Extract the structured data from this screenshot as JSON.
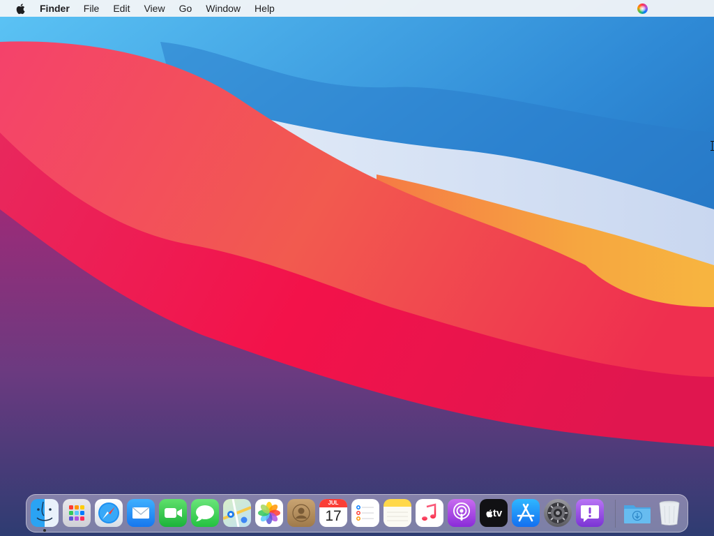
{
  "menubar": {
    "apple_icon": "apple-icon",
    "app_name": "Finder",
    "menus": [
      "File",
      "Edit",
      "View",
      "Go",
      "Window",
      "Help"
    ],
    "status_icons": [
      "siri-icon"
    ]
  },
  "dock": {
    "apps": [
      {
        "name": "Finder",
        "icon": "finder-icon",
        "running": true
      },
      {
        "name": "Launchpad",
        "icon": "launchpad-icon"
      },
      {
        "name": "Safari",
        "icon": "safari-icon"
      },
      {
        "name": "Mail",
        "icon": "mail-icon"
      },
      {
        "name": "FaceTime",
        "icon": "facetime-icon"
      },
      {
        "name": "Messages",
        "icon": "messages-icon"
      },
      {
        "name": "Maps",
        "icon": "maps-icon"
      },
      {
        "name": "Photos",
        "icon": "photos-icon"
      },
      {
        "name": "Contacts",
        "icon": "contacts-icon"
      },
      {
        "name": "Calendar",
        "icon": "calendar-icon",
        "month": "JUL",
        "day": "17"
      },
      {
        "name": "Reminders",
        "icon": "reminders-icon"
      },
      {
        "name": "Notes",
        "icon": "notes-icon"
      },
      {
        "name": "Music",
        "icon": "music-icon"
      },
      {
        "name": "Podcasts",
        "icon": "podcasts-icon"
      },
      {
        "name": "TV",
        "icon": "tv-icon",
        "label": "tv"
      },
      {
        "name": "App Store",
        "icon": "app-store-icon"
      },
      {
        "name": "System Preferences",
        "icon": "gear-icon"
      },
      {
        "name": "Feedback Assistant",
        "icon": "feedback-icon"
      }
    ],
    "stacks": [
      {
        "name": "Downloads",
        "icon": "downloads-folder-icon"
      },
      {
        "name": "Trash",
        "icon": "trash-icon"
      }
    ]
  },
  "colors": {
    "menubar_bg": "#f6f6f8",
    "wallpaper_blue": "#1f6fbf",
    "wallpaper_red": "#f0244e",
    "wallpaper_orange": "#f5a43a",
    "wallpaper_purple": "#5a3d7c"
  }
}
